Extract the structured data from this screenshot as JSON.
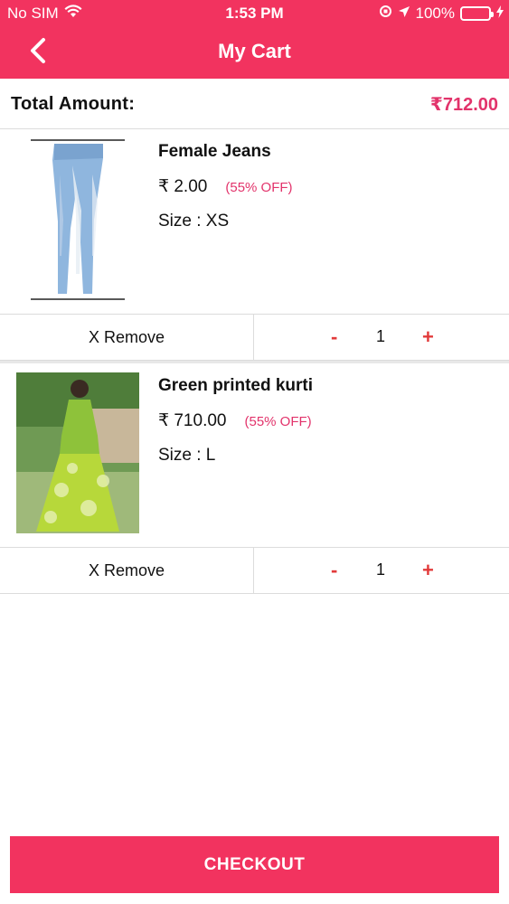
{
  "status_bar": {
    "carrier": "No SIM",
    "time": "1:53 PM",
    "battery": "100%"
  },
  "header": {
    "title": "My Cart"
  },
  "total": {
    "label": "Total Amount:",
    "amount": "₹712.00"
  },
  "items": [
    {
      "name": "Female Jeans",
      "price": "₹ 2.00",
      "discount": "(55% OFF)",
      "size": "Size : XS",
      "remove_label": "X  Remove",
      "minus": "-",
      "quantity": "1",
      "plus": "+"
    },
    {
      "name": "Green printed kurti",
      "price": "₹ 710.00",
      "discount": "(55% OFF)",
      "size": "Size : L",
      "remove_label": "X  Remove",
      "minus": "-",
      "quantity": "1",
      "plus": "+"
    }
  ],
  "checkout": {
    "label": "CHECKOUT"
  },
  "colors": {
    "brand": "#f2335f",
    "accent_text": "#e2336b",
    "qty_control": "#e23a3a"
  }
}
